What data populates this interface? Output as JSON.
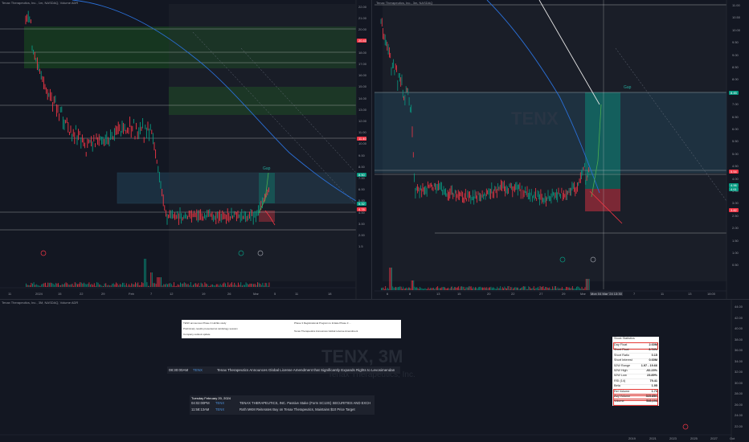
{
  "left_chart": {
    "header": "Tenax Therapeutics, Inc., 1m, NASDAQ, Volume ADR",
    "y_ticks": [
      "22.00",
      "21.00",
      "20.00",
      "19.00",
      "18.00",
      "17.00",
      "16.00",
      "15.00",
      "14.00",
      "13.00",
      "12.00",
      "11.00",
      "10.00",
      "9.00",
      "8.00",
      "7.00",
      "6.00",
      "5.00",
      "4.00",
      "3.00",
      "2.00",
      "1.5"
    ],
    "x_ticks": [
      "11",
      "2024",
      "15",
      "22",
      "29",
      "Feb",
      "7",
      "12",
      "19",
      "26",
      "Mar",
      "5",
      "11",
      "18"
    ],
    "price_tags": [
      {
        "label": "20.43",
        "color": "#f23645"
      },
      {
        "label": "11.40",
        "color": "#f23645"
      },
      {
        "label": "8.50",
        "color": "#089981"
      },
      {
        "label": "5.32",
        "color": "#089981"
      },
      {
        "label": "4.78",
        "color": "#f23645"
      }
    ],
    "gap_label": "Gap"
  },
  "right_chart": {
    "header": "Tenax Therapeutics, Inc., 3m, NASDAQ",
    "y_ticks": [
      "11.00",
      "10.50",
      "10.00",
      "9.50",
      "9.00",
      "8.50",
      "8.00",
      "7.50",
      "7.00",
      "6.50",
      "6.00",
      "5.50",
      "5.00",
      "4.50",
      "4.00",
      "3.50",
      "3.00",
      "2.50",
      "2.00",
      "1.50",
      "1.00",
      "0.50"
    ],
    "x_ticks": [
      "6",
      "8",
      "13",
      "15",
      "20",
      "22",
      "27",
      "29",
      "Mar",
      "Mon 04 Mar '24 13:30",
      "7",
      "11",
      "13",
      "18:00"
    ],
    "price_tags": [
      {
        "label": "8.45",
        "color": "#089981"
      },
      {
        "label": "5.54",
        "color": "#f23645"
      },
      {
        "label": "4.96",
        "color": "#089981"
      },
      {
        "label": "4.61",
        "color": "#089981"
      },
      {
        "label": "3.82",
        "color": "#f23645"
      }
    ],
    "gap_label": "Gap"
  },
  "bottom_panel": {
    "header": "Tenax Therapeutics, Inc., 3M, NASDAQ, Volume ADR",
    "watermark_ticker": "TENX, 3M",
    "watermark_name": "Tenax Therapeutics, Inc.",
    "y_ticks": [
      "44.00",
      "42.00",
      "40.00",
      "38.00",
      "36.00",
      "34.00",
      "32.00",
      "30.00",
      "28.00",
      "26.00",
      "24.00",
      "22.00"
    ],
    "x_ticks": [
      "2019",
      "2021",
      "2023",
      "2025",
      "2027",
      "Oct"
    ],
    "news_card": {
      "left_lines": [
        "TENX announces Phase 3 LEVEL study",
        "Preliminary results presented at cardiology session",
        "Company outlook update"
      ],
      "right_lines": [
        "Phase 3 Registrational Program to Initiate Phase 3 ...",
        "Tenax Therapeutics Announces Global License Amendment"
      ]
    },
    "headline": {
      "time": "08:30:00AM",
      "ticker": "TENX",
      "text": "Tenax Therapeutics Announces Global License Amendment that Significantly Expands Rights to Levosimendan"
    },
    "news_list": {
      "date": "Tuesday February 20, 2024",
      "items": [
        {
          "time": "04:02:00PM",
          "ticker": "TENX",
          "text": "TENAX THERAPEUTICS, INC. Passive Stake (Form SC13G) SECURITIES AND EXCH"
        },
        {
          "time": "11:58:13AM",
          "ticker": "TENX",
          "text": "Roth MKM Reiterates Buy on Tenax Therapeutics, Maintains $10 Price Target"
        }
      ]
    },
    "stats": {
      "title": "Stock Statistics",
      "rows": [
        {
          "k": "Day Float",
          "v": "2.60M",
          "hl": true
        },
        {
          "k": "Short Float",
          "v": "3.74%",
          "hl": false
        },
        {
          "k": "Short Ratio",
          "v": "0.15",
          "hl": false
        },
        {
          "k": "Short Interest",
          "v": "0.60M",
          "hl": false
        },
        {
          "k": "52W Range",
          "v": "1.97 - 19.66",
          "hl": false
        },
        {
          "k": "52W High",
          "v": "-92.23%",
          "hl": false
        },
        {
          "k": "52W Low",
          "v": "23.89%",
          "hl": false
        },
        {
          "k": "RSI (14)",
          "v": "79.41",
          "hl": false
        },
        {
          "k": "Beta",
          "v": "1.95",
          "hl": false
        },
        {
          "k": "Rel Volume",
          "v": "1.73",
          "hl": true
        },
        {
          "k": "Avg Volume",
          "v": "315.85K",
          "hl": true
        },
        {
          "k": "Volume",
          "v": "546,194",
          "hl": true
        }
      ]
    }
  }
}
